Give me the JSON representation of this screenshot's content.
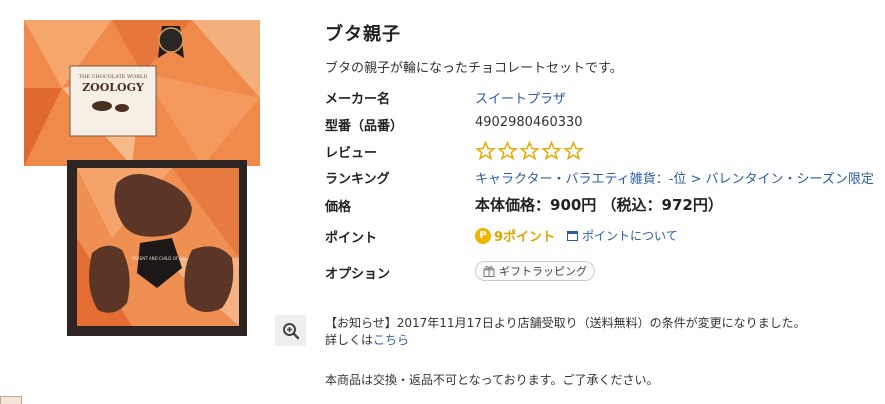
{
  "product": {
    "title": "ブタ親子",
    "description": "ブタの親子が輪になったチョコレートセットです。",
    "image": {
      "box_brand": "ZOOLOGY",
      "box_subtitle": "THE CHOCOLATE WORLD",
      "insert_label": "PARENT AND CHILD OF PIG",
      "colors": {
        "box": "#ef8a4a",
        "tray": "#2b2421",
        "chocolate": "#5b3526"
      }
    }
  },
  "details": {
    "maker_label": "メーカー名",
    "maker_value": "スイートプラザ",
    "model_label": "型番（品番）",
    "model_value": "4902980460330",
    "review_label": "レビュー",
    "review_stars": 0,
    "review_max": 5,
    "ranking_label": "ランキング",
    "ranking_value": "キャラクター・バラエティ雑貨：-位 > バレンタイン・シーズン限定",
    "price_label": "価格",
    "price_value": "本体価格：900円 （税込：972円）",
    "point_label": "ポイント",
    "point_icon": "P",
    "point_value": "9ポイント",
    "point_about": "ポイントについて",
    "option_label": "オプション",
    "option_chip": "ギフトラッピング"
  },
  "notice": {
    "line1": "【お知らせ】2017年11月17日より店舗受取り（送料無料）の条件が変更になりました。",
    "line2_prefix": "詳しくは",
    "line2_link": "こちら"
  },
  "disclaimer": "本商品は交換・返品不可となっております。ご了承ください。",
  "colors": {
    "link": "#2b5da6",
    "star": "#e8a800",
    "point": "#f0b400"
  }
}
